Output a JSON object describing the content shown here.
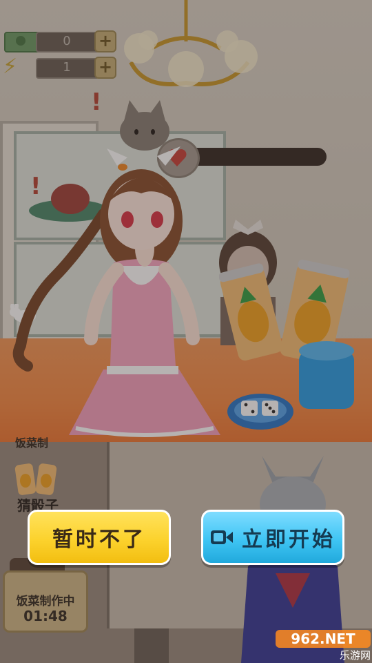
{
  "hud": {
    "cash_value": "0",
    "energy_value": "1",
    "plus_symbol": "+"
  },
  "side": {
    "partial_label": "饭菜制",
    "dice_game_label": "猜骰子",
    "cooking_label": "饭菜制作中",
    "cooking_timer": "01:48"
  },
  "dialog": {
    "decline_label": "暂时不了",
    "start_label": "立即开始"
  },
  "watermark": {
    "text_top": "962.NET",
    "text_bottom": "乐游网"
  },
  "colors": {
    "decline_button": "#fcd22d",
    "start_button": "#3fc5f4",
    "counter": "#f58d4a"
  }
}
